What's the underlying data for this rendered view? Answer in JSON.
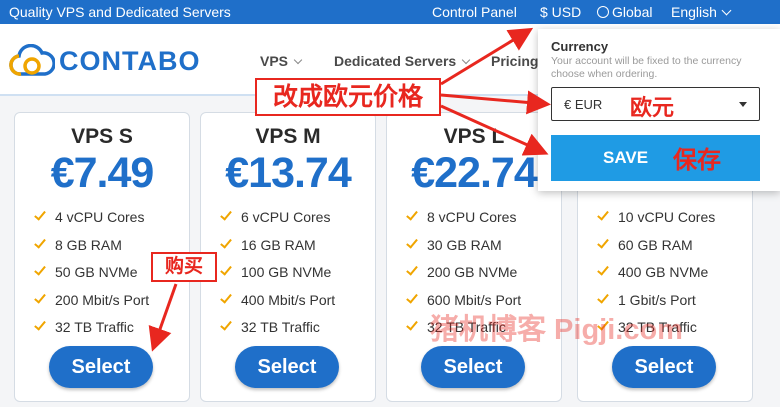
{
  "topbar": {
    "tagline": "Quality VPS and Dedicated Servers",
    "control_panel": "Control Panel",
    "currency": "$ USD",
    "region": "Global",
    "language": "English"
  },
  "header": {
    "brand": "CONTABO",
    "nav": [
      {
        "label": "VPS"
      },
      {
        "label": "Dedicated Servers"
      },
      {
        "label": "Pricing"
      }
    ]
  },
  "plans": [
    {
      "name": "VPS S",
      "price": "€7.49",
      "features": [
        "4 vCPU Cores",
        "8 GB RAM",
        "50 GB NVMe",
        "200 Mbit/s Port",
        "32 TB Traffic"
      ],
      "button": "Select"
    },
    {
      "name": "VPS M",
      "price": "€13.74",
      "features": [
        "6 vCPU Cores",
        "16 GB RAM",
        "100 GB NVMe",
        "400 Mbit/s Port",
        "32 TB Traffic"
      ],
      "button": "Select"
    },
    {
      "name": "VPS L",
      "price": "€22.74",
      "features": [
        "8 vCPU Cores",
        "30 GB RAM",
        "200 GB NVMe",
        "600 Mbit/s Port",
        "32 TB Traffic"
      ],
      "button": "Select"
    },
    {
      "name": "",
      "price": "",
      "features": [
        "10 vCPU Cores",
        "60 GB RAM",
        "400 GB NVMe",
        "1 Gbit/s Port",
        "32 TB Traffic"
      ],
      "button": "Select"
    }
  ],
  "currency_popup": {
    "title": "Currency",
    "note": "Your account will be fixed to the currency choose when ordering.",
    "selected": "€ EUR",
    "save_label": "SAVE"
  },
  "annotations": {
    "change_to_euro": "改成欧元价格",
    "euro": "欧元",
    "save": "保存",
    "buy": "购买",
    "watermark": "猪机博客 Pigji.com"
  },
  "colors": {
    "brand_blue": "#1f6fc9",
    "save_blue": "#1f9be4",
    "check_orange": "#f0a500",
    "annotation_red": "#e8271f"
  }
}
